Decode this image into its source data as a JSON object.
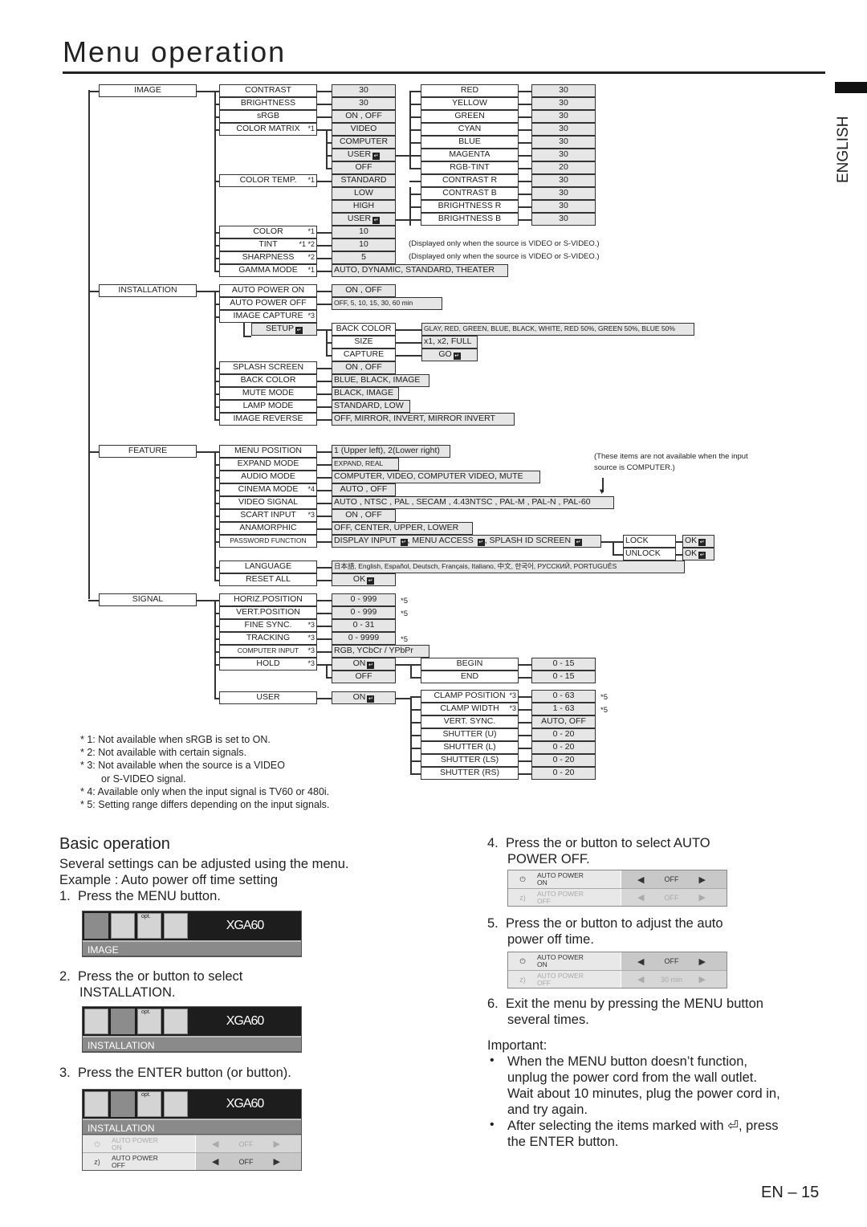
{
  "page": {
    "title": "Menu operation",
    "language_tab": "ENGLISH",
    "page_number": "EN – 15"
  },
  "menu_tree": {
    "top_menus": [
      "IMAGE",
      "INSTALLATION",
      "FEATURE",
      "SIGNAL"
    ],
    "image": {
      "items": [
        {
          "label": "CONTRAST",
          "note": "",
          "value": "30"
        },
        {
          "label": "BRIGHTNESS",
          "note": "",
          "value": "30"
        },
        {
          "label": "sRGB",
          "note": "",
          "value": "ON , OFF"
        },
        {
          "label": "COLOR MATRIX",
          "note": "*1",
          "value": "VIDEO"
        },
        {
          "label": "COLOR TEMP.",
          "note": "*1",
          "value": "STANDARD"
        },
        {
          "label": "COLOR",
          "note": "*1",
          "value": "10"
        },
        {
          "label": "TINT",
          "note": "*1 *2",
          "value": "10"
        },
        {
          "label": "SHARPNESS",
          "note": "*2",
          "value": "5"
        },
        {
          "label": "GAMMA MODE",
          "note": "*1",
          "value": "AUTO, DYNAMIC, STANDARD, THEATER"
        }
      ],
      "color_matrix_options": [
        "VIDEO",
        "COMPUTER",
        "USER",
        "OFF"
      ],
      "color_temp_options": [
        "STANDARD",
        "LOW",
        "HIGH",
        "USER"
      ],
      "user_matrix": [
        {
          "label": "RED",
          "value": "30"
        },
        {
          "label": "YELLOW",
          "value": "30"
        },
        {
          "label": "GREEN",
          "value": "30"
        },
        {
          "label": "CYAN",
          "value": "30"
        },
        {
          "label": "BLUE",
          "value": "30"
        },
        {
          "label": "MAGENTA",
          "value": "30"
        },
        {
          "label": "RGB-TINT",
          "value": "20"
        }
      ],
      "user_temp": [
        {
          "label": "CONTRAST R",
          "value": "30"
        },
        {
          "label": "CONTRAST B",
          "value": "30"
        },
        {
          "label": "BRIGHTNESS R",
          "value": "30"
        },
        {
          "label": "BRIGHTNESS B",
          "value": "30"
        }
      ],
      "video_only_note": "(Displayed only when the source is VIDEO or S-VIDEO.)"
    },
    "installation": {
      "items": [
        {
          "label": "AUTO POWER ON",
          "note": "",
          "value": "ON , OFF"
        },
        {
          "label": "AUTO POWER OFF",
          "note": "",
          "value": "OFF,  5,  10,  15,  30,  60 min"
        },
        {
          "label": "IMAGE CAPTURE",
          "note": "*3",
          "value": ""
        },
        {
          "label": "SPLASH SCREEN",
          "note": "",
          "value": "ON , OFF"
        },
        {
          "label": "BACK COLOR",
          "note": "",
          "value": "BLUE, BLACK, IMAGE"
        },
        {
          "label": "MUTE MODE",
          "note": "",
          "value": "BLACK, IMAGE"
        },
        {
          "label": "LAMP MODE",
          "note": "",
          "value": "STANDARD, LOW"
        },
        {
          "label": "IMAGE REVERSE",
          "note": "",
          "value": "OFF, MIRROR, INVERT, MIRROR INVERT"
        }
      ],
      "setup_label": "SETUP",
      "setup_items": [
        {
          "label": "BACK COLOR",
          "value": "GLAY, RED, GREEN, BLUE, BLACK, WHITE, RED 50%, GREEN 50%, BLUE 50%"
        },
        {
          "label": "SIZE",
          "value": "x1, x2, FULL"
        },
        {
          "label": "CAPTURE",
          "value": "GO"
        }
      ]
    },
    "feature": {
      "items": [
        {
          "label": "MENU POSITION",
          "note": "",
          "value": "1 (Upper left), 2(Lower right)"
        },
        {
          "label": "EXPAND MODE",
          "note": "",
          "value": "EXPAND, REAL"
        },
        {
          "label": "AUDIO MODE",
          "note": "",
          "value": "COMPUTER, VIDEO, COMPUTER VIDEO, MUTE"
        },
        {
          "label": "CINEMA MODE",
          "note": "*4",
          "value": "AUTO , OFF"
        },
        {
          "label": "VIDEO SIGNAL",
          "note": "",
          "value": "AUTO , NTSC , PAL , SECAM , 4.43NTSC , PAL-M , PAL-N , PAL-60"
        },
        {
          "label": "SCART INPUT",
          "note": "*3",
          "value": "ON , OFF"
        },
        {
          "label": "ANAMORPHIC",
          "note": "",
          "value": "OFF, CENTER, UPPER, LOWER"
        },
        {
          "label": "PASSWORD FUNCTION",
          "note": "",
          "value": "DISPLAY INPUT ⏎, MENU ACCESS ⏎, SPLASH ID SCREEN ⏎"
        },
        {
          "label": "LANGUAGE",
          "note": "",
          "value": "日本語, English, Español, Deutsch, Français, Italiano, 中文, 한국어, РУССКИЙ, PORTUGUÊS"
        },
        {
          "label": "RESET ALL",
          "note": "",
          "value": "OK"
        }
      ],
      "computer_note": "(These items are not available when the input source is COMPUTER.)",
      "lock_options": [
        {
          "label": "LOCK",
          "value": "OK"
        },
        {
          "label": "UNLOCK",
          "value": "OK"
        }
      ]
    },
    "signal": {
      "items": [
        {
          "label": "HORIZ.POSITION",
          "note": "",
          "value": "0 - 999",
          "star": "*5"
        },
        {
          "label": "VERT.POSITION",
          "note": "",
          "value": "0 - 999",
          "star": "*5"
        },
        {
          "label": "FINE SYNC.",
          "note": "*3",
          "value": "0 - 31",
          "star": ""
        },
        {
          "label": "TRACKING",
          "note": "*3",
          "value": "0 - 9999",
          "star": "*5"
        },
        {
          "label": "COMPUTER INPUT",
          "note": "*3",
          "value": "RGB, YCbCr / YPbPr",
          "star": ""
        },
        {
          "label": "HOLD",
          "note": "*3",
          "value": "ON",
          "star": ""
        },
        {
          "label": "USER",
          "note": "",
          "value": "ON",
          "star": ""
        }
      ],
      "hold_off": "OFF",
      "hold_sub": [
        {
          "label": "BEGIN",
          "value": "0 - 15"
        },
        {
          "label": "END",
          "value": "0 - 15"
        }
      ],
      "user_sub": [
        {
          "label": "CLAMP POSITION",
          "note": "*3",
          "value": "0 - 63",
          "star": "*5"
        },
        {
          "label": "CLAMP WIDTH",
          "note": "*3",
          "value": "1 - 63",
          "star": "*5"
        },
        {
          "label": "VERT. SYNC.",
          "note": "",
          "value": "AUTO, OFF",
          "star": ""
        },
        {
          "label": "SHUTTER (U)",
          "note": "",
          "value": "0 - 20",
          "star": ""
        },
        {
          "label": "SHUTTER (L)",
          "note": "",
          "value": "0 - 20",
          "star": ""
        },
        {
          "label": "SHUTTER (LS)",
          "note": "",
          "value": "0 - 20",
          "star": ""
        },
        {
          "label": "SHUTTER (RS)",
          "note": "",
          "value": "0 - 20",
          "star": ""
        }
      ]
    }
  },
  "footnotes": [
    "* 1: Not available when sRGB is set to ON.",
    "* 2: Not available with certain signals.",
    "* 3: Not available when the source is a VIDEO",
    "      or S-VIDEO signal.",
    "* 4: Available only when the input signal is TV60 or 480i.",
    "* 5: Setting range differs depending on the input signals."
  ],
  "basic_operation": {
    "heading": "Basic operation",
    "intro": "Several settings can be adjusted using the menu.",
    "example": "Example : Auto power off time setting",
    "steps": [
      {
        "num": "1.",
        "line1": "Press the MENU button.",
        "line2": ""
      },
      {
        "num": "2.",
        "line1": "Press the       or       button to select",
        "line2": "INSTALLATION."
      },
      {
        "num": "3.",
        "line1": "Press the ENTER button (or         button).",
        "line2": ""
      },
      {
        "num": "4.",
        "line1": "Press the       or       button to select AUTO",
        "line2": "POWER OFF."
      },
      {
        "num": "5.",
        "line1": "Press the       or       button to adjust the auto",
        "line2": "power off time."
      },
      {
        "num": "6.",
        "line1": "Exit the menu by pressing the MENU button",
        "line2": "several times."
      }
    ],
    "osd": {
      "model": "XGA60",
      "opt_label": "opt.",
      "section_image": "IMAGE",
      "section_installation": "INSTALLATION",
      "row_on": "AUTO POWER ON",
      "row_off": "AUTO POWER OFF",
      "row_on_l1": "AUTO POWER",
      "row_on_l2": "ON",
      "row_off_l1": "AUTO POWER",
      "row_off_l2": "OFF",
      "value_off": "OFF",
      "value_30": "30 min"
    },
    "important": {
      "heading": "Important:",
      "bullets": [
        [
          "When the MENU button doesn’t function,",
          "unplug the power cord from the wall outlet.",
          "Wait about 10 minutes, plug the power cord in,",
          "and try again."
        ],
        [
          "After selecting the items marked with      ⏎, press",
          "the ENTER button."
        ]
      ]
    }
  }
}
